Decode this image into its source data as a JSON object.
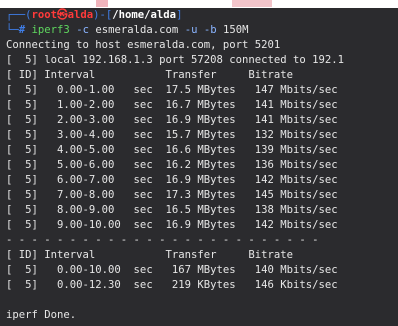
{
  "prompt": {
    "user": "root",
    "at": "㉿",
    "host": "alda",
    "path": "/home/alda",
    "hash": "#"
  },
  "command": {
    "name": "iperf3",
    "flag_c": "-c",
    "host": "esmeralda.com",
    "flag_u": "-u",
    "flag_b": "-b",
    "bandwidth": "150M"
  },
  "output": [
    "Connecting to host esmeralda.com, port 5201",
    "[  5] local 192.168.1.3 port 57208 connected to 192.1",
    "[ ID] Interval           Transfer     Bitrate",
    "[  5]   0.00-1.00   sec  17.5 MBytes   147 Mbits/sec",
    "[  5]   1.00-2.00   sec  16.7 MBytes   141 Mbits/sec",
    "[  5]   2.00-3.00   sec  16.9 MBytes   141 Mbits/sec",
    "[  5]   3.00-4.00   sec  15.7 MBytes   132 Mbits/sec",
    "[  5]   4.00-5.00   sec  16.6 MBytes   139 Mbits/sec",
    "[  5]   5.00-6.00   sec  16.2 MBytes   136 Mbits/sec",
    "[  5]   6.00-7.00   sec  16.9 MBytes   142 Mbits/sec",
    "[  5]   7.00-8.00   sec  17.3 MBytes   145 Mbits/sec",
    "[  5]   8.00-9.00   sec  16.5 MBytes   138 Mbits/sec",
    "[  5]   9.00-10.00  sec  16.9 MBytes   142 Mbits/sec",
    "- - - - - - - - - - - - - - - - - - - - - - - - -",
    "[ ID] Interval           Transfer     Bitrate",
    "[  5]   0.00-10.00  sec   167 MBytes   140 Mbits/sec",
    "[  5]   0.00-12.30  sec   219 KBytes   146 Kbits/sec",
    "",
    "iperf Done."
  ],
  "colors": {
    "background": "#2b2b2e",
    "prompt_bracket": "#3f7ee8",
    "prompt_user": "#ff3a3a",
    "command": "#5fd75f"
  }
}
